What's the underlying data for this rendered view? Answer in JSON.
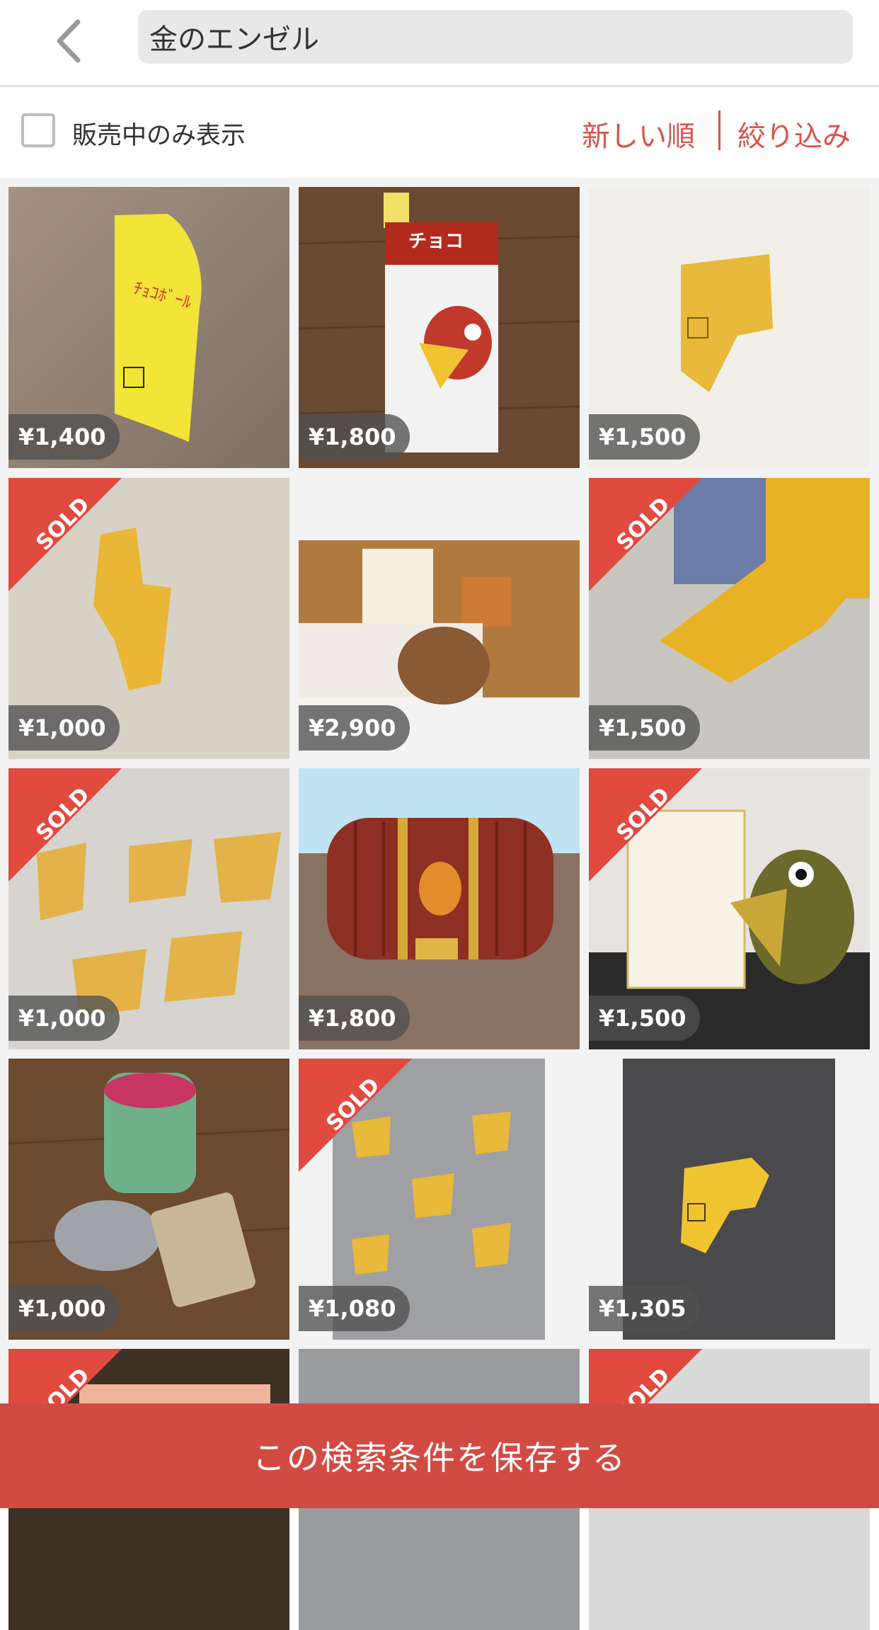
{
  "search": {
    "query": "金のエンゼル"
  },
  "filter": {
    "checkbox_label": "販売中のみ表示",
    "sort_label": "新しい順",
    "filter_label": "絞り込み"
  },
  "sold_label": "SOLD",
  "items": [
    {
      "price": "¥1,400",
      "sold": false
    },
    {
      "price": "¥1,800",
      "sold": false
    },
    {
      "price": "¥1,500",
      "sold": false
    },
    {
      "price": "¥1,000",
      "sold": true
    },
    {
      "price": "¥2,900",
      "sold": false
    },
    {
      "price": "¥1,500",
      "sold": true
    },
    {
      "price": "¥1,000",
      "sold": true
    },
    {
      "price": "¥1,800",
      "sold": false
    },
    {
      "price": "¥1,500",
      "sold": true
    },
    {
      "price": "¥1,000",
      "sold": false
    },
    {
      "price": "¥1,080",
      "sold": true
    },
    {
      "price": "¥1,305",
      "sold": false
    }
  ],
  "save_button": {
    "label": "この検索条件を保存する"
  },
  "colors": {
    "accent": "#d9534a",
    "save_bar": "#d24b43",
    "price_pill": "#505050"
  }
}
